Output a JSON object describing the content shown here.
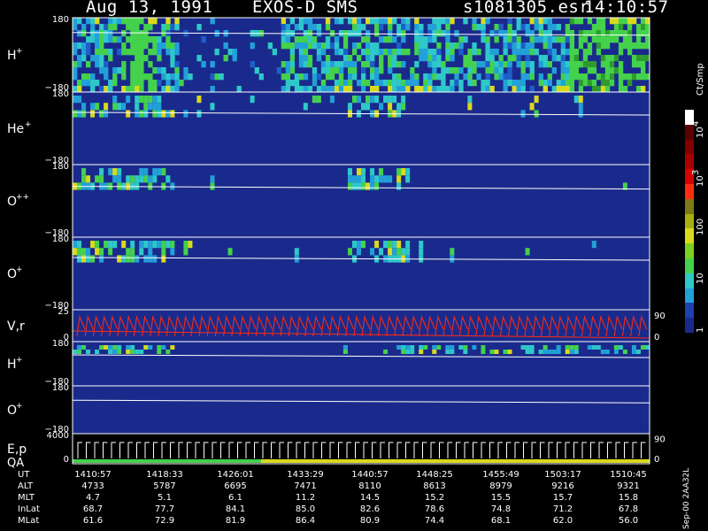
{
  "header": {
    "date": "Aug 13, 1991",
    "instrument": "EXOS-D SMS",
    "file_name": "s1081305.esr",
    "created_time": "14:10:57"
  },
  "colorbar": {
    "unit_label": "Ct/Smp",
    "tick_labels": [
      "1",
      "10",
      "100",
      "10",
      "10"
    ],
    "exponents": [
      "",
      "",
      "",
      "3",
      "4"
    ],
    "tick_values": [
      1,
      10,
      100,
      1000,
      10000
    ],
    "colors": [
      "#1a2a8c",
      "#1e3fae",
      "#22a0d8",
      "#2ec8c8",
      "#44d14c",
      "#7cd021",
      "#d9d91e",
      "#a7b013",
      "#7f7a17",
      "#ff2a10",
      "#d80000",
      "#aa0000",
      "#820000",
      "#5c0000",
      "#ffffff"
    ]
  },
  "footer": {
    "stamp": "Sep-00  2AA32L"
  },
  "chart_data": {
    "type": "heatmap",
    "x_axis": {
      "rows": [
        {
          "name": "UT",
          "values": [
            "1410:57",
            "1418:33",
            "1426:01",
            "1433:29",
            "1440:57",
            "1448:25",
            "1455:49",
            "1503:17",
            "1510:45"
          ]
        },
        {
          "name": "ALT",
          "values": [
            "4733",
            "5787",
            "6695",
            "7471",
            "8110",
            "8613",
            "8979",
            "9216",
            "9321"
          ]
        },
        {
          "name": "MLT",
          "values": [
            "4.7",
            "5.1",
            "6.1",
            "11.2",
            "14.5",
            "15.2",
            "15.5",
            "15.7",
            "15.8"
          ]
        },
        {
          "name": "InLat",
          "values": [
            "68.7",
            "77.7",
            "84.1",
            "85.0",
            "82.6",
            "78.6",
            "74.8",
            "71.2",
            "67.8"
          ]
        },
        {
          "name": "MLat",
          "values": [
            "61.6",
            "72.9",
            "81.9",
            "86.4",
            "80.9",
            "74.4",
            "68.1",
            "62.0",
            "56.0"
          ]
        }
      ]
    },
    "panels": [
      {
        "label": "H",
        "charge": "+",
        "ymax": "180",
        "ymin": "−180",
        "activity": "high",
        "line_frac": 0.2
      },
      {
        "label": "He",
        "charge": "+",
        "ymax": "180",
        "ymin": "−180",
        "activity": "low",
        "line_frac": 0.28
      },
      {
        "label": "O",
        "charge": "++",
        "ymax": "180",
        "ymin": "−180",
        "activity": "low",
        "line_frac": 0.3
      },
      {
        "label": "O",
        "charge": "+",
        "ymax": "180",
        "ymin": "−180",
        "activity": "low",
        "line_frac": 0.28
      },
      {
        "label": "V,r",
        "charge": "",
        "ymax": "25",
        "ymin": "0",
        "right_max": "90",
        "right_min": "0",
        "activity": "line"
      },
      {
        "label": "H",
        "charge": "+",
        "ymax": "180",
        "ymin": "−180",
        "activity": "mid",
        "line_frac": 0.3
      },
      {
        "label": "O",
        "charge": "+",
        "ymax": "180",
        "ymin": "−180",
        "activity": "none",
        "line_frac": 0.3
      },
      {
        "label": "E,p",
        "charge": "",
        "label2": "QA",
        "ymax": "4000",
        "ymin": "0",
        "right_max": "90",
        "right_min": "0",
        "activity": "energy"
      }
    ]
  }
}
